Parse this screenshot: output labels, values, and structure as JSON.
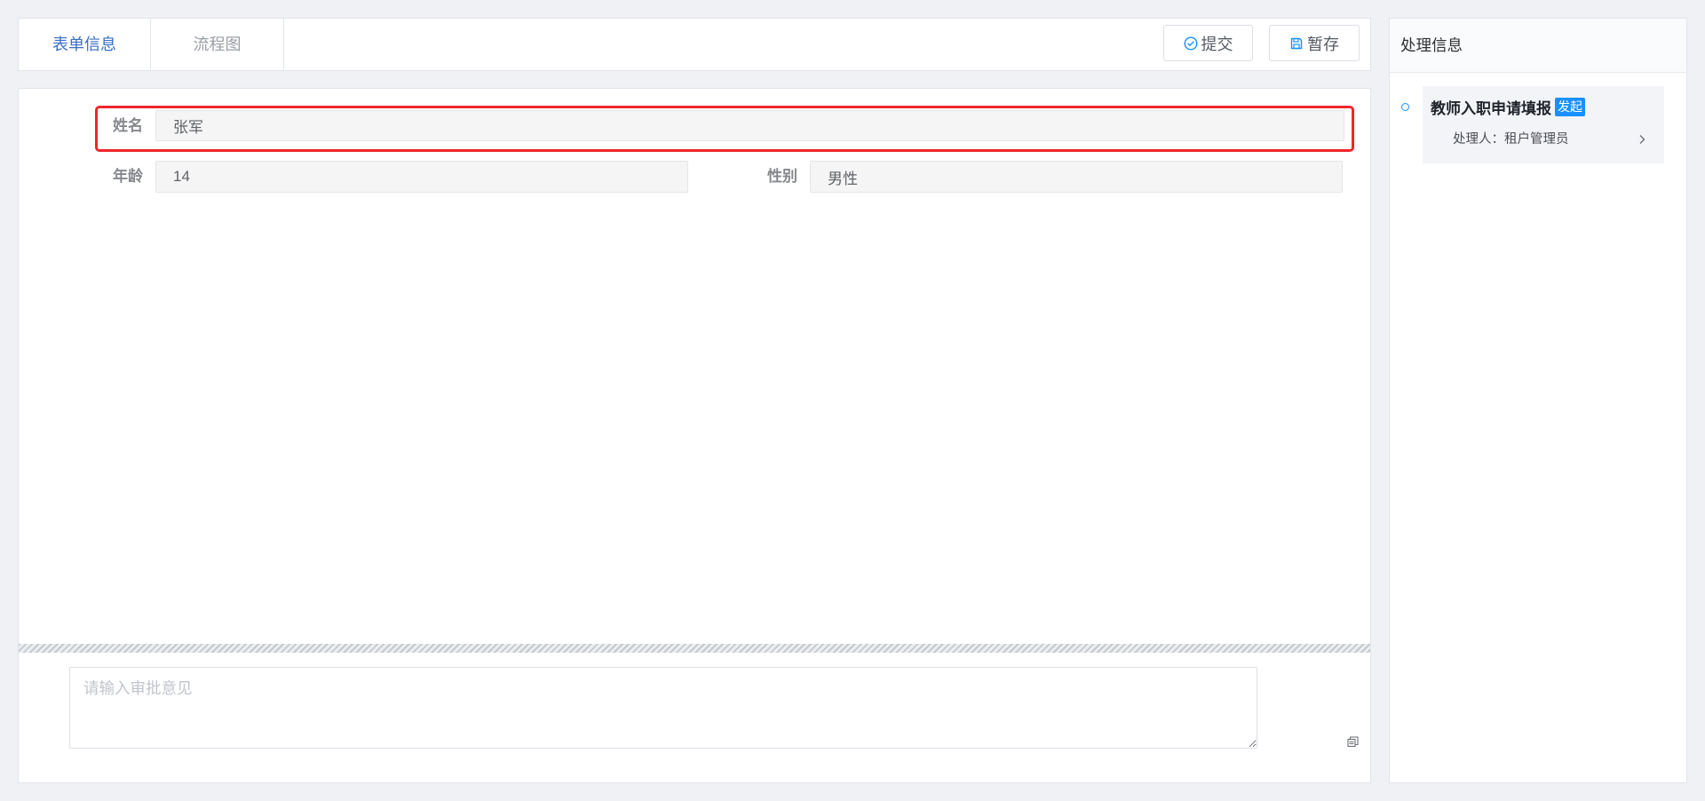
{
  "tabs": [
    {
      "label": "表单信息",
      "active": true
    },
    {
      "label": "流程图",
      "active": false
    }
  ],
  "toolbar": {
    "submit": {
      "label": "提交",
      "icon": "check-circle-icon"
    },
    "save": {
      "label": "暂存",
      "icon": "save-icon"
    }
  },
  "form": {
    "name": {
      "label": "姓名",
      "value": "张军"
    },
    "age": {
      "label": "年龄",
      "value": "14"
    },
    "gender": {
      "label": "性别",
      "value": "男性"
    }
  },
  "approval": {
    "placeholder": "请输入审批意见"
  },
  "process_panel": {
    "title": "处理信息",
    "steps": [
      {
        "title": "教师入职申请填报",
        "badge": "发起",
        "handler": "处理人：租户管理员"
      }
    ]
  },
  "icons": {
    "submit": "check-circle-icon",
    "save": "save-icon",
    "step_open": "chevron-right-icon",
    "textarea_tool": "copy-icon"
  },
  "colors": {
    "page_background": "#eff1f5",
    "active_tab": "#3a6fc4",
    "accent": "#1890ff",
    "highlight": "#f0262a",
    "card_background": "#f2f4f8"
  }
}
